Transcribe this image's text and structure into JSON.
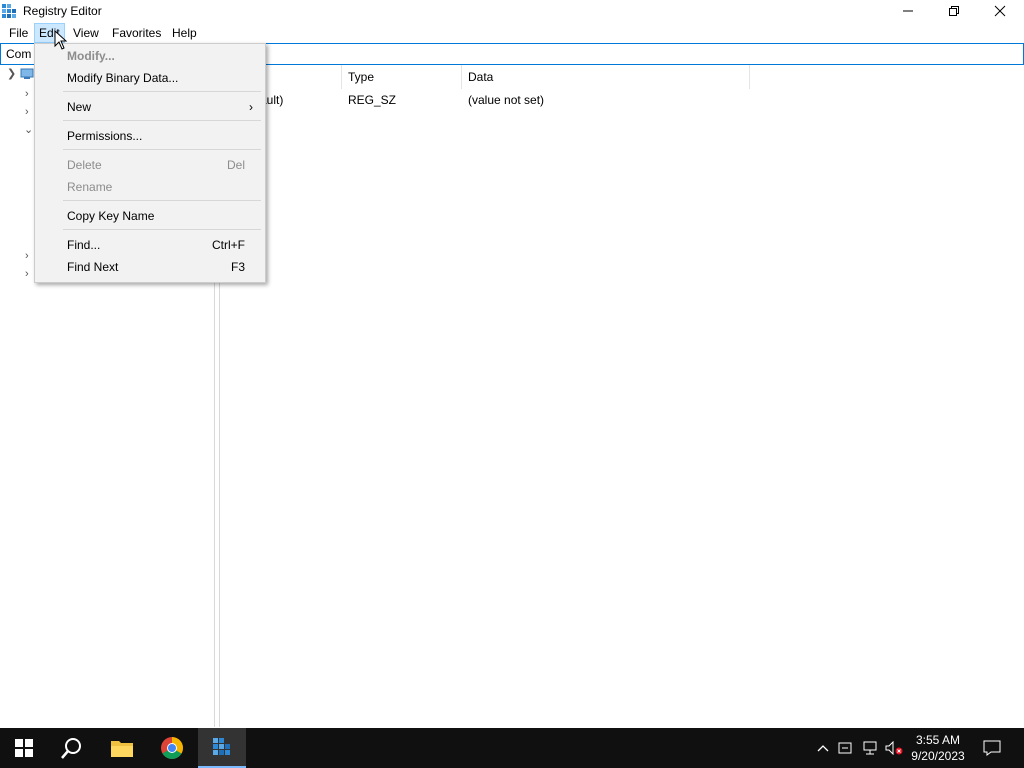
{
  "window": {
    "title": "Registry Editor"
  },
  "menubar": {
    "file": "File",
    "edit": "Edit",
    "view": "View",
    "favorites": "Favorites",
    "help": "Help"
  },
  "address": {
    "value": "Com"
  },
  "list": {
    "headers": {
      "type": "Type",
      "data": "Data"
    },
    "rows": [
      {
        "name": "ault)",
        "type": "REG_SZ",
        "data": "(value not set)"
      }
    ]
  },
  "edit_menu": {
    "modify": "Modify...",
    "modify_binary": "Modify Binary Data...",
    "new": "New",
    "permissions": "Permissions...",
    "delete": "Delete",
    "delete_shortcut": "Del",
    "rename": "Rename",
    "copy_key_name": "Copy Key Name",
    "find": "Find...",
    "find_shortcut": "Ctrl+F",
    "find_next": "Find Next",
    "find_next_shortcut": "F3"
  },
  "taskbar": {
    "time": "3:55 AM",
    "date": "9/20/2023"
  },
  "colors": {
    "accent": "#0078d7",
    "taskbar": "#101010",
    "menu_bg": "#f2f2f2",
    "menu_hover": "#cce8ff"
  }
}
